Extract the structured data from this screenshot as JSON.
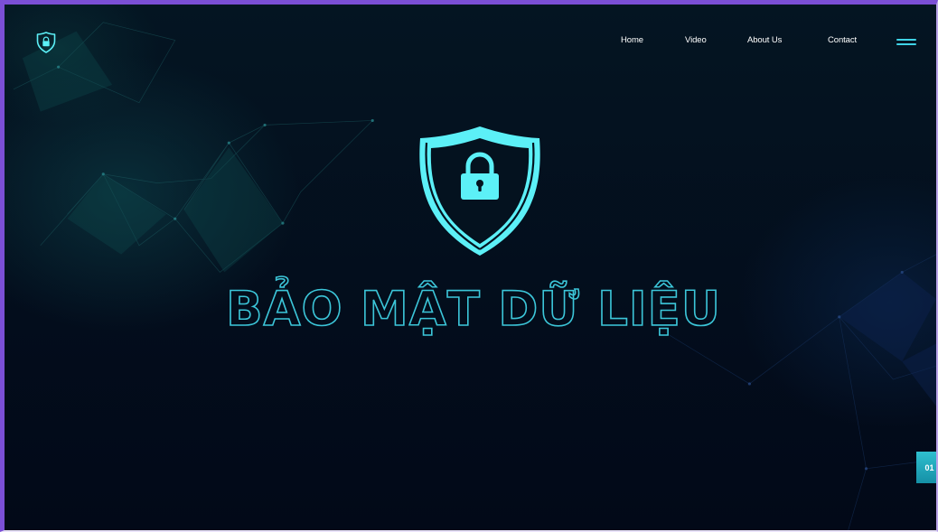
{
  "nav": {
    "items": [
      {
        "label": "Home"
      },
      {
        "label": "Video"
      },
      {
        "label": "About Us"
      },
      {
        "label": "Contact"
      }
    ]
  },
  "hero": {
    "title": "BẢO MẬT DỮ LIỆU",
    "icon": "shield-lock-icon"
  },
  "slider": {
    "current": "01"
  },
  "colors": {
    "accent": "#5cf0f7",
    "title_outline": "#3cc6d9",
    "background": "#030d1c",
    "frame": "#7b4fd6",
    "indicator": "#2fbfcf"
  }
}
